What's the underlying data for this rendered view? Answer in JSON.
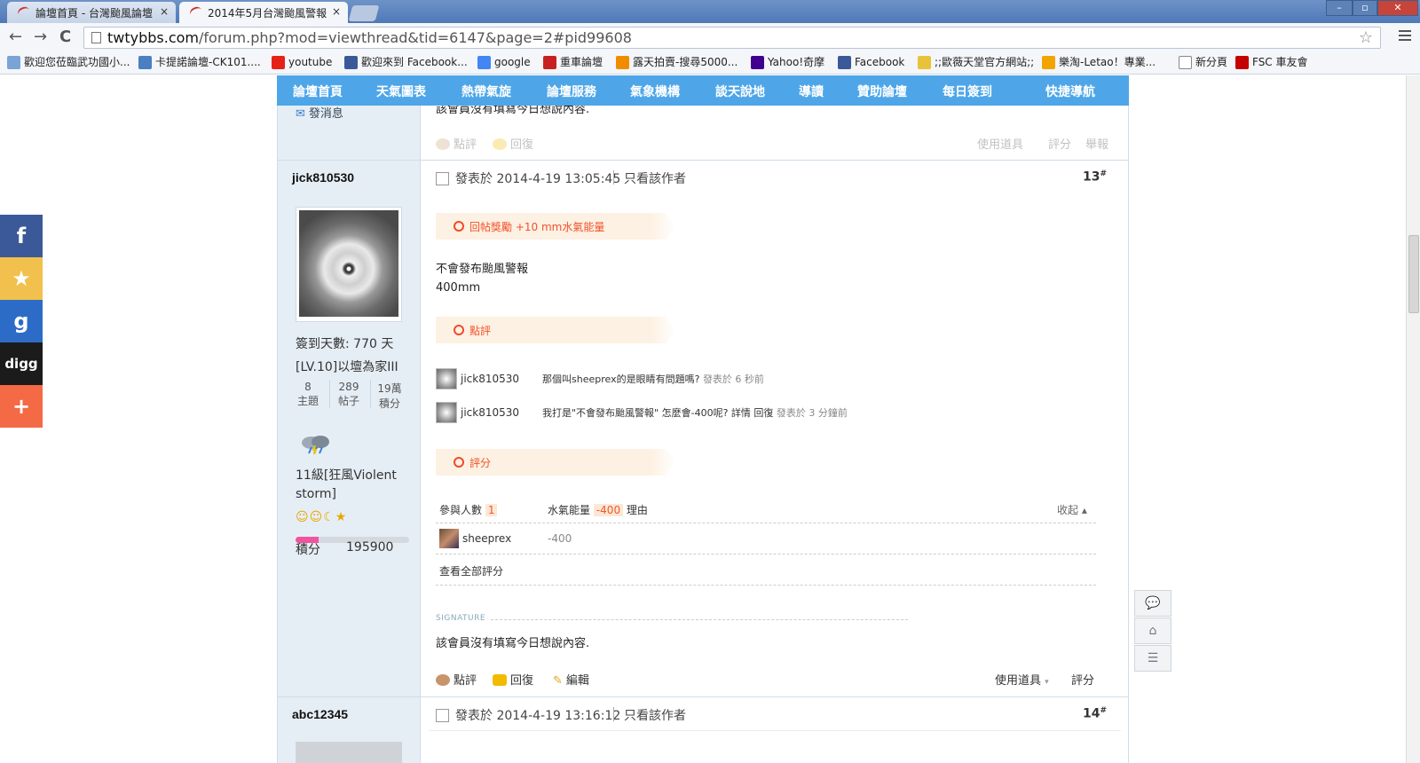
{
  "browser": {
    "tabs": [
      {
        "title": "論壇首頁 - 台灣颱風論壇"
      },
      {
        "title": "2014年5月台灣颱風警報"
      }
    ],
    "close_glyph": "×",
    "url_host": "twtybbs.com",
    "url_path": "/forum.php?mod=viewthread&tid=6147&page=2#pid99608",
    "window_controls": [
      "–",
      "▫",
      "✕"
    ],
    "nav": [
      "←",
      "→",
      "C"
    ],
    "bookmarks": [
      {
        "label": "歡迎您莅臨武功國小...",
        "icon": "flag-icon",
        "color": "#7aa3d6"
      },
      {
        "label": "卡提諾論壇-CK101....",
        "icon": "castle-icon",
        "color": "#4a7fc1"
      },
      {
        "label": "youtube",
        "icon": "youtube-icon",
        "color": "#e62117"
      },
      {
        "label": "歡迎來到 Facebook...",
        "icon": "facebook-icon",
        "color": "#3b5998"
      },
      {
        "label": "google",
        "icon": "google-icon",
        "color": "#4285f4"
      },
      {
        "label": "重車論壇",
        "icon": "bowtie-icon",
        "color": "#c82020"
      },
      {
        "label": "露天拍賣-搜尋5000...",
        "icon": "ruten-icon",
        "color": "#f08c00"
      },
      {
        "label": "Yahoo!奇摩",
        "icon": "yahoo-icon",
        "color": "#400090"
      },
      {
        "label": "Facebook",
        "icon": "facebook-icon",
        "color": "#3b5998"
      },
      {
        "label": ";;歐薇天堂官方網站;;",
        "icon": "crown-icon",
        "color": "#e8c33a"
      },
      {
        "label": "樂淘-Letao！專業...",
        "icon": "letao-icon",
        "color": "#f2a400"
      },
      {
        "label": "新分頁",
        "icon": "page-icon",
        "color": "#ffffff"
      },
      {
        "label": "FSC 車友會",
        "icon": "fsc-icon",
        "color": "#c40000"
      }
    ]
  },
  "topnav": {
    "items": [
      "論壇首頁",
      "天氣圖表",
      "熱帶氣旋",
      "論壇服務",
      "氣象機構",
      "談天說地",
      "導讀",
      "贊助論壇",
      "每日簽到",
      "快捷導航"
    ]
  },
  "prev_post": {
    "send_msg": "發消息",
    "sig_text": "該會員沒有填寫今日想說內容.",
    "actions": [
      "點評",
      "回復"
    ],
    "right_actions": [
      "使用道具",
      "評分",
      "舉報"
    ]
  },
  "post13": {
    "author": "jick810530",
    "checkin": "簽到天數: 770 天",
    "level": "[LV.10]以壇為家III",
    "stats": [
      {
        "value": "8",
        "label": "主題"
      },
      {
        "value": "289",
        "label": "帖子"
      },
      {
        "value": "19萬",
        "label": "積分"
      }
    ],
    "rank": "11級[狂風Violent storm]",
    "emotes": "☺☺☾★",
    "score_label": "積分",
    "score_value": "195900",
    "progress": 0.2,
    "posted": "發表於 2014-4-19 13:05:45",
    "only_author": "只看該作者",
    "floor": "13",
    "floor_mark": "#",
    "reward_banner": "回帖獎勵 +10 mm水氣能量",
    "body_lines": [
      "不會發布颱風警報",
      "400mm"
    ],
    "comment_banner": "點評",
    "comments": [
      {
        "user": "jick810530",
        "text": "那個叫sheeprex的是眼睛有問題嗎?",
        "time": "發表於 6 秒前"
      },
      {
        "user": "jick810530",
        "text": "我打是\"不會發布颱風警報\" 怎麼會-400呢? 詳情 回復",
        "time": "發表於 3 分鐘前"
      }
    ],
    "rating_banner": "評分",
    "rating": {
      "participants_label": "參與人數",
      "participants": "1",
      "energy_label": "水氣能量",
      "energy_value": "-400",
      "reason_label": "理由",
      "collapse": "收起",
      "rows": [
        {
          "user": "sheeprex",
          "value": "-400"
        }
      ],
      "view_all": "查看全部評分"
    },
    "signature_label": "SIGNATURE",
    "sig_text": "該會員沒有填寫今日想說內容.",
    "actions": [
      "點評",
      "回復",
      "編輯"
    ],
    "right_actions": [
      "使用道具",
      "評分"
    ]
  },
  "post14": {
    "author": "abc12345",
    "posted": "發表於 2014-4-19 13:16:12",
    "only_author": "只看該作者",
    "floor": "14",
    "floor_mark": "#"
  },
  "share": [
    {
      "name": "facebook",
      "glyph": "f",
      "color": "#3b5998"
    },
    {
      "name": "favorites",
      "glyph": "★",
      "color": "#f2c04c"
    },
    {
      "name": "google",
      "glyph": "g",
      "color": "#2d6cc6"
    },
    {
      "name": "digg",
      "glyph": "digg",
      "color": "#1b1b1b"
    },
    {
      "name": "more",
      "glyph": "+",
      "color": "#f46a45"
    }
  ],
  "floating": [
    "💬",
    "⌂",
    "☰"
  ]
}
